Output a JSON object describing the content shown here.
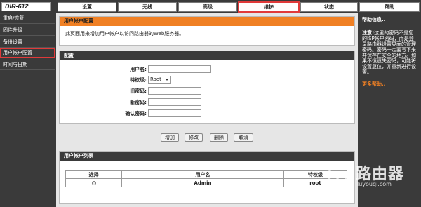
{
  "logo": "DIR-612",
  "tabs": [
    {
      "label": "设置"
    },
    {
      "label": "无线"
    },
    {
      "label": "高级"
    },
    {
      "label": "维护"
    },
    {
      "label": "状态"
    },
    {
      "label": "帮助"
    }
  ],
  "sidebar": {
    "items": [
      {
        "label": "重启/恢复"
      },
      {
        "label": "固件升级"
      },
      {
        "label": "备份设置"
      },
      {
        "label": "用户帐户配置"
      },
      {
        "label": "时间与日期"
      }
    ]
  },
  "intro": {
    "title": "用户帐户配置",
    "description": "此页面用来增加用户帐户以访问路由器的Web服务器。"
  },
  "config": {
    "title": "配置",
    "username_label": "用户名:",
    "privilege_label": "特权级:",
    "privilege_value": "Root",
    "old_password_label": "旧密码:",
    "new_password_label": "新密码:",
    "confirm_password_label": "确认密码:"
  },
  "buttons": {
    "add": "增加",
    "modify": "修改",
    "delete": "删除",
    "cancel": "取消"
  },
  "accounts": {
    "title": "用户帐户列表",
    "headers": {
      "select": "选择",
      "username": "用户名",
      "privilege": "特权级"
    },
    "rows": [
      {
        "username": "Admin",
        "privilege": "root"
      }
    ]
  },
  "help": {
    "title": "帮助信息..",
    "note_label": "注意!",
    "note_text": "这里的密码不是您的ISP帐户密码，而是登录路由器设置界面的管理密码。密码一定要写下来并保存在安全的地方。如果不慎遗失密码，可能将设置复位，并重新进行设置。",
    "more": "更多帮助.."
  },
  "watermark": {
    "brand": "路由器",
    "url": "luyouqi.com"
  }
}
